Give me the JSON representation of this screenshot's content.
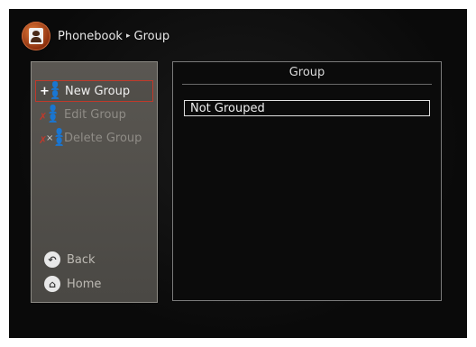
{
  "header": {
    "breadcrumb": [
      "Phonebook",
      "Group"
    ],
    "separator": "▸",
    "icon": "phonebook-contact-icon"
  },
  "menu": {
    "items": [
      {
        "label": "New Group",
        "icon": "add-group-icon",
        "state": "selected"
      },
      {
        "label": "Edit Group",
        "icon": "edit-group-icon",
        "state": "disabled"
      },
      {
        "label": "Delete Group",
        "icon": "delete-group-icon",
        "state": "disabled"
      }
    ],
    "nav": [
      {
        "label": "Back",
        "icon": "back-icon"
      },
      {
        "label": "Home",
        "icon": "home-icon"
      }
    ]
  },
  "panel": {
    "title": "Group",
    "rows": [
      "Not Grouped"
    ]
  },
  "colors": {
    "selection_border": "#c0392b",
    "accent_icon": "#d06a30"
  }
}
